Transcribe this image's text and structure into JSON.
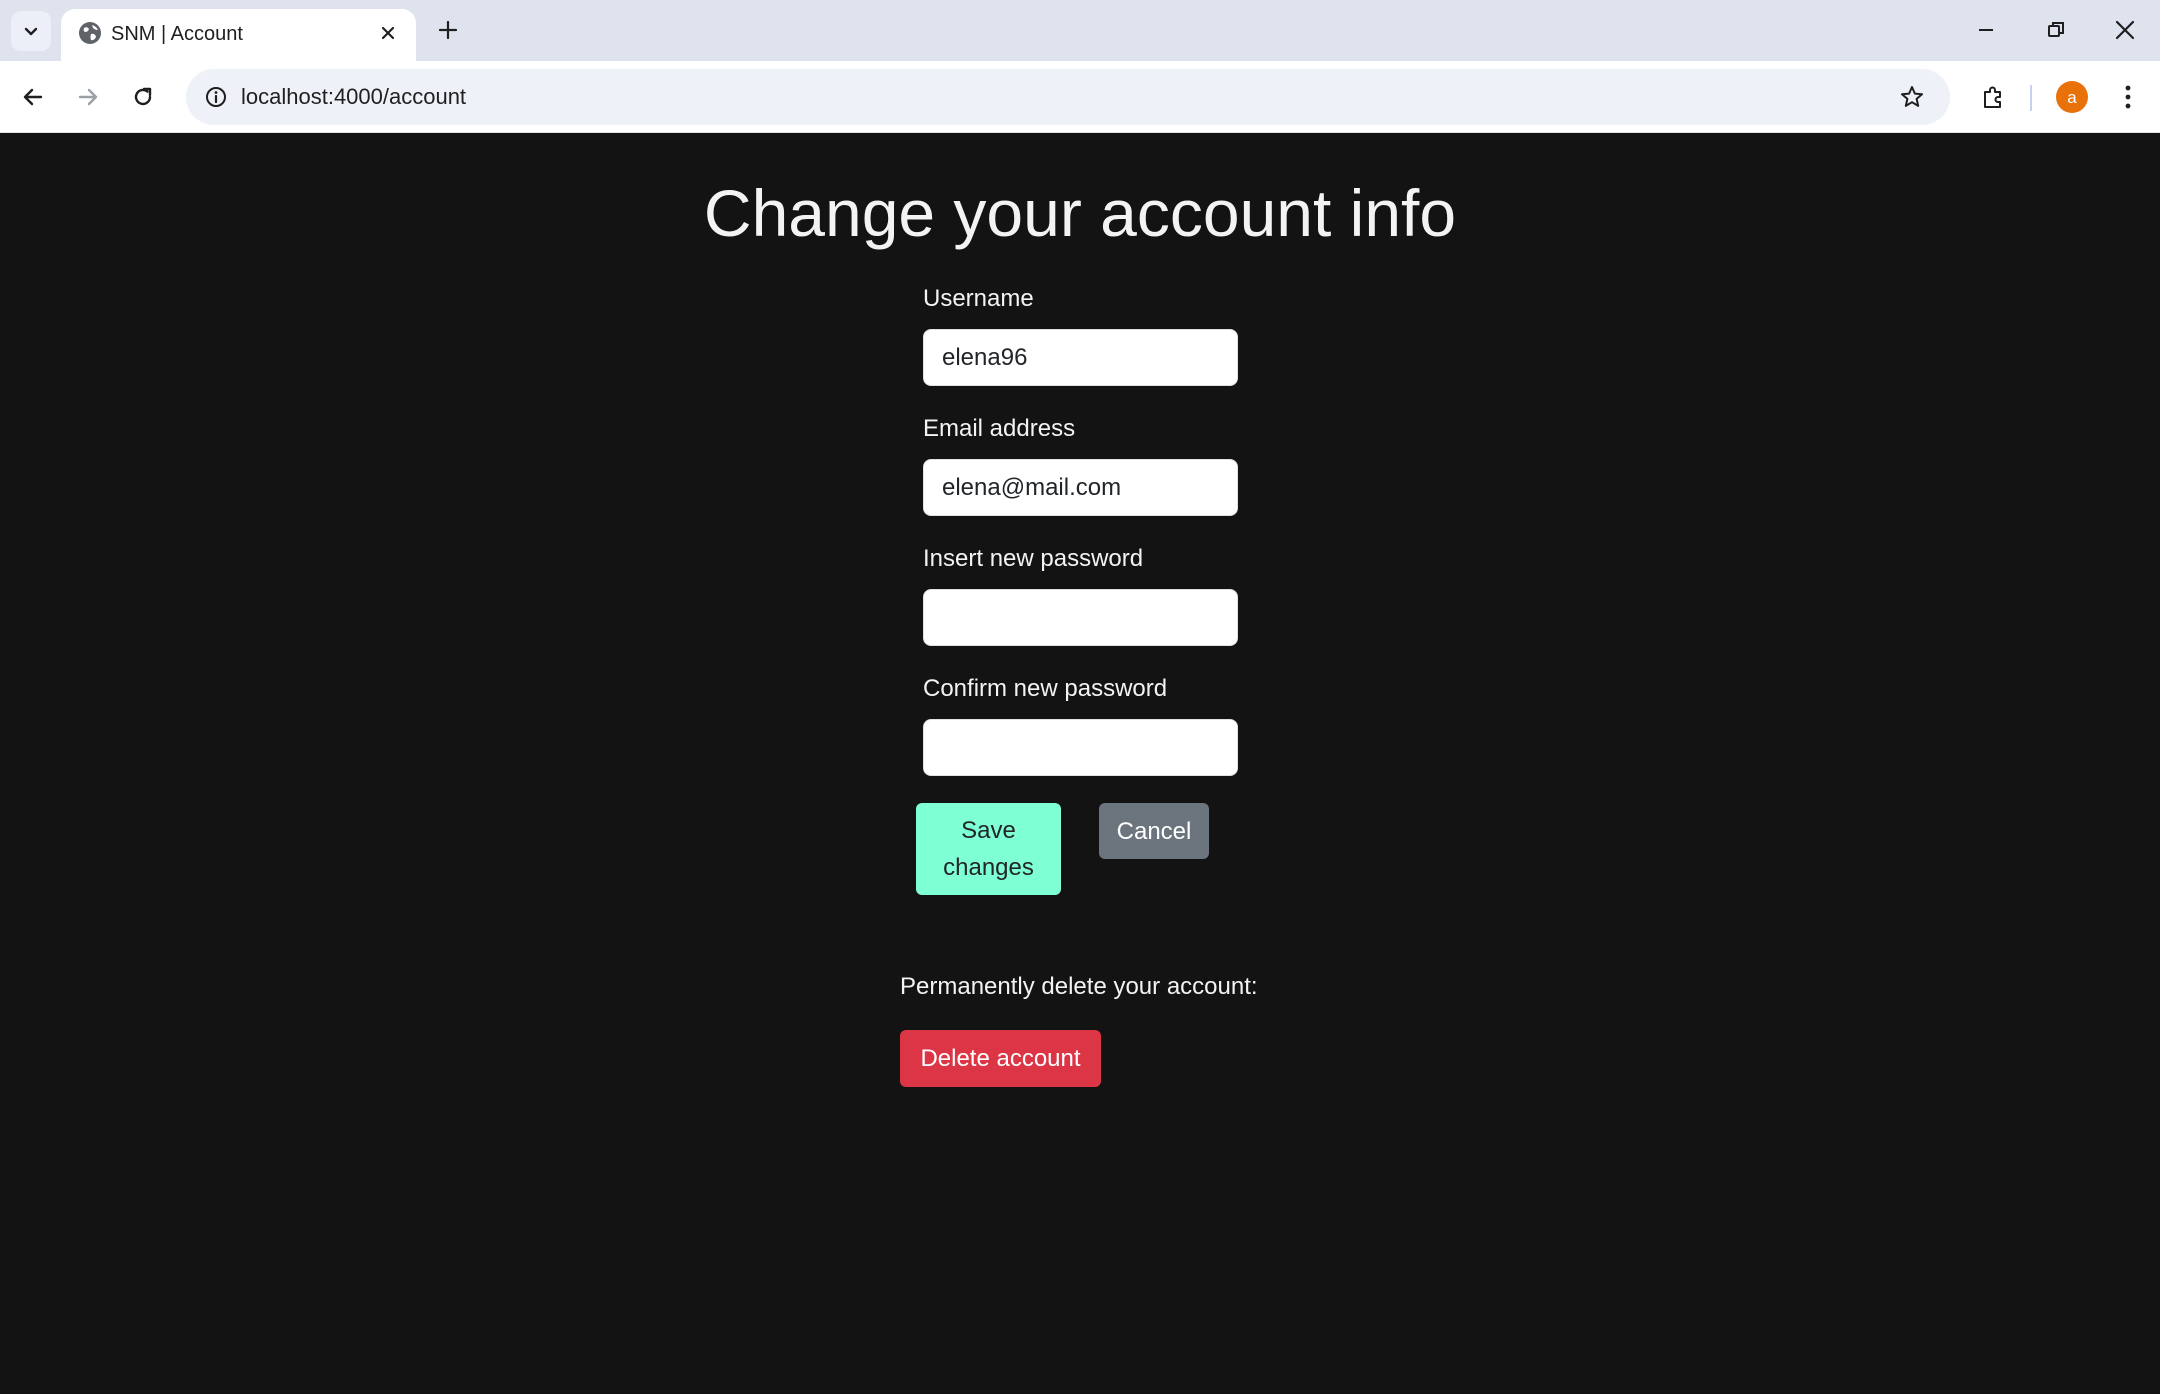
{
  "browser": {
    "tab_title": "SNM | Account",
    "url": "localhost:4000/account",
    "profile_initial": "a",
    "profile_color": "#e8710a"
  },
  "page": {
    "title": "Change your account info",
    "fields": {
      "username": {
        "label": "Username",
        "value": "elena96"
      },
      "email": {
        "label": "Email address",
        "value": "elena@mail.com"
      },
      "new_password": {
        "label": "Insert new password",
        "value": ""
      },
      "confirm_password": {
        "label": "Confirm new password",
        "value": ""
      }
    },
    "buttons": {
      "save_line1": "Save",
      "save_line2": "changes",
      "cancel": "Cancel"
    },
    "delete": {
      "label": "Permanently delete your account:",
      "button": "Delete account"
    }
  },
  "colors": {
    "background": "#131313",
    "save": "#7fffd4",
    "cancel": "#6c757d",
    "danger": "#dc3545"
  },
  "icons": [
    "tab-search-icon",
    "globe-icon",
    "close-icon",
    "plus-icon",
    "minimize-icon",
    "restore-icon",
    "back-arrow-icon",
    "forward-arrow-icon",
    "reload-icon",
    "info-icon",
    "star-icon",
    "extensions-icon",
    "kebab-menu-icon"
  ]
}
